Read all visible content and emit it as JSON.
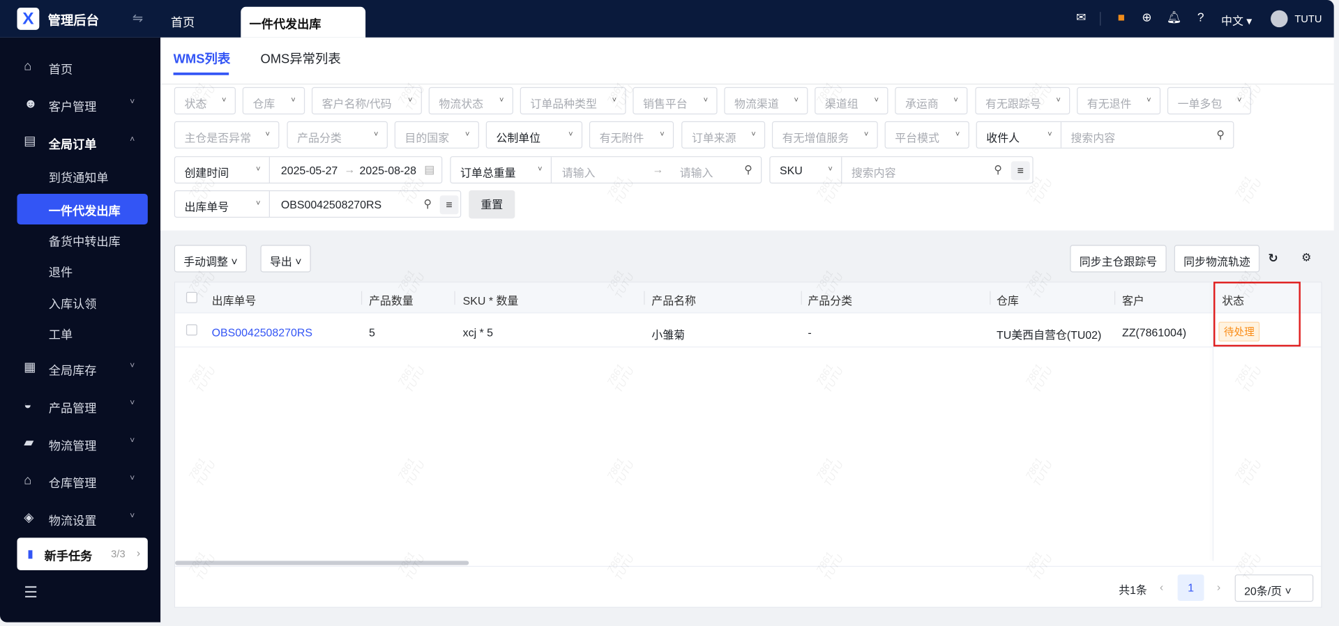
{
  "app": {
    "title": "管理后台",
    "user": "TUTU",
    "language": "中文",
    "watermark": [
      "7861",
      "TUTU"
    ]
  },
  "tabs": {
    "home": "首页",
    "active": "一件代发出库"
  },
  "sidebar": {
    "items": [
      {
        "label": "首页",
        "icon": "home-icon"
      },
      {
        "label": "客户管理",
        "icon": "users-icon"
      },
      {
        "label": "全局订单",
        "icon": "clipboard-icon"
      },
      {
        "label": "到货通知单"
      },
      {
        "label": "一件代发出库"
      },
      {
        "label": "备货中转出库"
      },
      {
        "label": "退件"
      },
      {
        "label": "入库认领"
      },
      {
        "label": "工单"
      },
      {
        "label": "全局库存",
        "icon": "warehouse-icon"
      },
      {
        "label": "产品管理",
        "icon": "bag-icon"
      },
      {
        "label": "物流管理",
        "icon": "truck-icon"
      },
      {
        "label": "仓库管理",
        "icon": "house-icon"
      },
      {
        "label": "物流设置",
        "icon": "box-settings-icon"
      }
    ],
    "new_task": {
      "label": "新手任务",
      "progress": "3/3"
    }
  },
  "subtabs": [
    "WMS列表",
    "OMS异常列表"
  ],
  "filters": {
    "row1": [
      "状态",
      "仓库",
      "客户名称/代码",
      "物流状态",
      "订单品种类型",
      "销售平台",
      "物流渠道",
      "渠道组",
      "承运商",
      "有无跟踪号",
      "有无退件",
      "一单多包"
    ],
    "row2": [
      "主仓是否异常",
      "产品分类",
      "目的国家",
      "公制单位",
      "有无附件",
      "订单来源",
      "有无增值服务",
      "平台模式"
    ],
    "recipient": {
      "select": "收件人",
      "placeholder": "搜索内容"
    },
    "created": {
      "select": "创建时间",
      "start": "2025-05-27",
      "end": "2025-08-28"
    },
    "weight": {
      "select": "订单总重量",
      "min_placeholder": "请输入",
      "max_placeholder": "请输入"
    },
    "sku": {
      "select": "SKU",
      "placeholder": "搜索内容"
    },
    "order_no": {
      "select": "出库单号",
      "value": "OBS0042508270RS"
    },
    "reset": "重置"
  },
  "toolbar": {
    "manual": "手动调整",
    "export": "导出",
    "sync_tracking": "同步主仓跟踪号",
    "sync_logistics": "同步物流轨迹"
  },
  "table": {
    "columns": [
      "出库单号",
      "产品数量",
      "SKU * 数量",
      "产品名称",
      "产品分类",
      "仓库",
      "客户",
      "状态"
    ],
    "rows": [
      {
        "order_no": "OBS0042508270RS",
        "qty": "5",
        "sku": "xcj * 5",
        "name": "小雏菊",
        "category": "-",
        "warehouse": "TU美西自营仓(TU02)",
        "customer": "ZZ(7861004)",
        "status": "待处理"
      }
    ]
  },
  "pagination": {
    "total": "共1条",
    "page": "1",
    "page_size": "20条/页"
  },
  "colors": {
    "accent": "#3355f5",
    "status_pending": "#fa8c16",
    "highlight": "#e02020"
  }
}
